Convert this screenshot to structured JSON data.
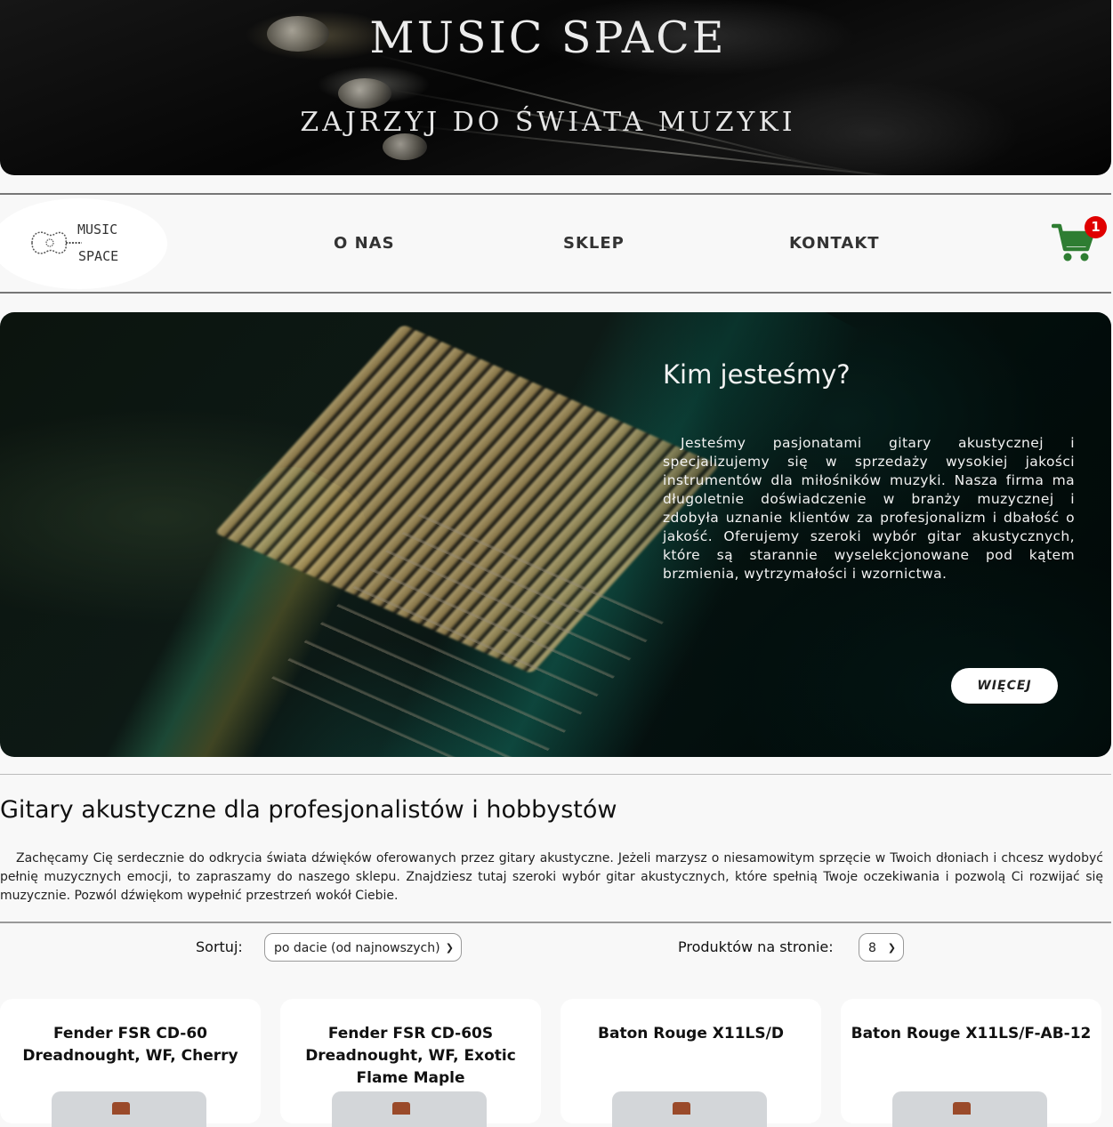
{
  "banner": {
    "title": "MUSIC SPACE",
    "subtitle": "ZAJRZYJ DO ŚWIATA MUZYKI"
  },
  "nav": {
    "logo": {
      "line1": "MUSIC",
      "line2": "SPACE"
    },
    "links": [
      "O NAS",
      "SKLEP",
      "KONTAKT"
    ],
    "cart": {
      "icon": "shopping-cart-icon",
      "count": "1",
      "color": "#2e7d32",
      "badge_color": "#e00000"
    }
  },
  "hero": {
    "title": "Kim jesteśmy?",
    "text": "Jesteśmy pasjonatami gitary akustycznej i specjalizujemy się w sprzedaży wysokiej jakości instrumentów dla miłośników muzyki. Nasza firma ma długoletnie doświadczenie w branży muzycznej i zdobyła uznanie klientów za profesjonalizm i dbałość o jakość. Oferujemy szeroki wybór gitar akustycznych, które są starannie wyselekcjonowane pod kątem brzmienia, wytrzymałości i wzornictwa.",
    "button": "WIĘCEJ"
  },
  "section": {
    "title": "Gitary akustyczne dla profesjonalistów i hobbystów",
    "text": "Zachęcamy Cię serdecznie do odkrycia świata dźwięków oferowanych przez gitary akustyczne. Jeżeli marzysz o niesamowitym sprzęcie w Twoich dłoniach i chcesz wydobyć pełnię muzycznych emocji, to zapraszamy do naszego sklepu. Znajdziesz tutaj szeroki wybór gitar akustycznych, które spełnią Twoje oczekiwania i pozwolą Ci rozwijać się muzycznie. Pozwól dźwiękom wypełnić przestrzeń wokół Ciebie."
  },
  "controls": {
    "sort_label": "Sortuj:",
    "sort_value": "po dacie (od najnowszych)",
    "per_page_label": "Produktów na stronie:",
    "per_page_value": "8"
  },
  "products": [
    {
      "title": "Fender FSR CD-60 Dreadnought, WF, Cherry"
    },
    {
      "title": "Fender FSR CD-60S Dreadnought, WF, Exotic Flame Maple"
    },
    {
      "title": "Baton Rouge X11LS/D"
    },
    {
      "title": "Baton Rouge X11LS/F-AB-12"
    }
  ]
}
